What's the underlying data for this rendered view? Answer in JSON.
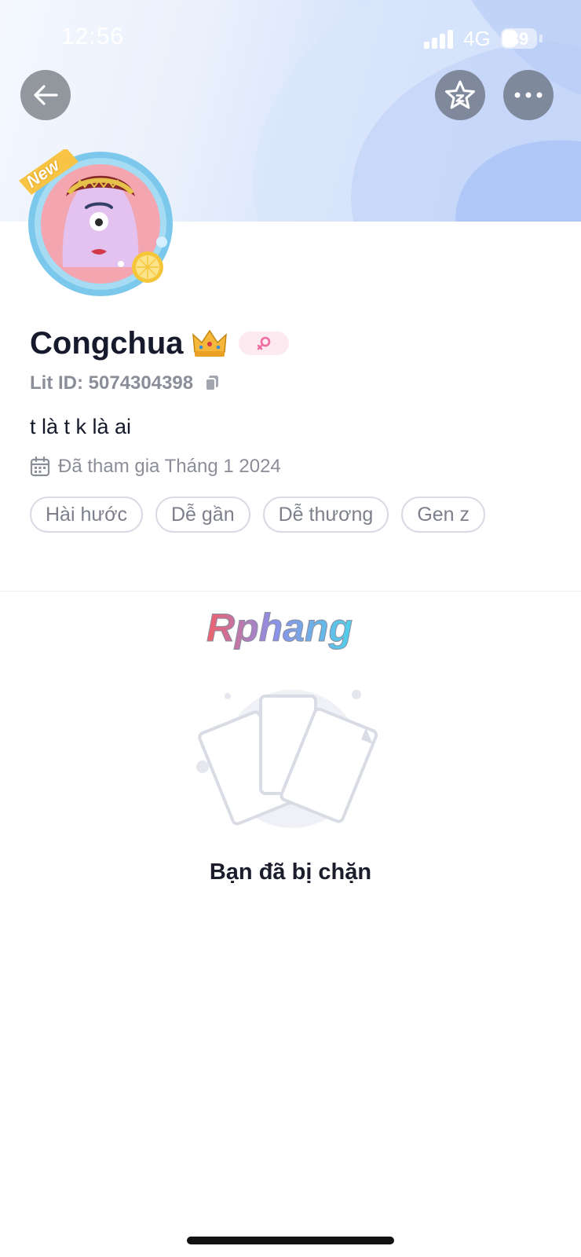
{
  "status_bar": {
    "time": "12:56",
    "network": "4G",
    "battery": "39"
  },
  "header": {
    "back_icon": "arrow-left-icon",
    "favorite_icon": "star-icon",
    "more_icon": "ellipsis-icon"
  },
  "avatar": {
    "badge_text": "New"
  },
  "profile": {
    "name": "Congchua",
    "name_emoji": "crown",
    "gender": "female",
    "lit_id": "Lit ID: 5074304398",
    "bio": "t là t k là ai",
    "joined": "Đã tham gia Tháng 1 2024",
    "tags": [
      "Hài hước",
      "Dễ gần",
      "Dễ thương",
      "Gen z"
    ]
  },
  "watermark": "Rphang",
  "empty_state": {
    "message": "Bạn đã bị chặn"
  },
  "colors": {
    "accent_pink": "#f06ba0",
    "text_primary": "#161a2c",
    "text_secondary": "#8b8e99",
    "tag_border": "#d9dae3"
  }
}
